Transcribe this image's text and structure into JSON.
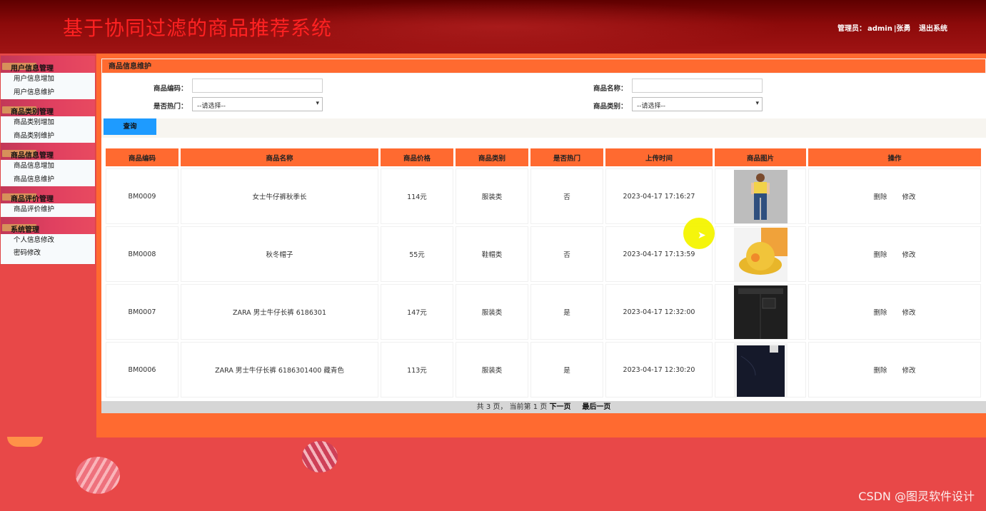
{
  "header": {
    "title": "基于协同过滤的商品推荐系统",
    "admin_label": "管理员：",
    "admin_name": "admin",
    "user_name": "张勇",
    "logout_label": "退出系统"
  },
  "sidebar": {
    "groups": [
      {
        "title": "用户信息管理",
        "items": [
          "用户信息增加",
          "用户信息维护"
        ]
      },
      {
        "title": "商品类别管理",
        "items": [
          "商品类别增加",
          "商品类别维护"
        ]
      },
      {
        "title": "商品信息管理",
        "items": [
          "商品信息增加",
          "商品信息维护"
        ]
      },
      {
        "title": "商品评价管理",
        "items": [
          "商品评价维护"
        ]
      },
      {
        "title": "系统管理",
        "items": [
          "个人信息修改",
          "密码修改"
        ]
      }
    ]
  },
  "panel": {
    "title": "商品信息维护",
    "search": {
      "code_label": "商品编码：",
      "code_value": "",
      "name_label": "商品名称：",
      "name_value": "",
      "hot_label": "是否热门：",
      "hot_selected": "--请选择--",
      "category_label": "商品类别：",
      "category_selected": "--请选择--",
      "button_label": "查询"
    },
    "table": {
      "headers": [
        "商品编码",
        "商品名称",
        "商品价格",
        "商品类别",
        "是否热门",
        "上传时间",
        "商品图片",
        "操作"
      ],
      "rows": [
        {
          "code": "BM0009",
          "name": "女士牛仔裤秋季长",
          "price": "114元",
          "category": "服装类",
          "hot": "否",
          "time": "2023-04-17 17:16:27",
          "image": "jeans-woman-image",
          "delete": "删除",
          "edit": "修改"
        },
        {
          "code": "BM0008",
          "name": "秋冬帽子",
          "price": "55元",
          "category": "鞋帽类",
          "hot": "否",
          "time": "2023-04-17 17:13:59",
          "image": "yellow-hat-image",
          "delete": "删除",
          "edit": "修改"
        },
        {
          "code": "BM0007",
          "name": "ZARA 男士牛仔长裤 6186301",
          "price": "147元",
          "category": "服装类",
          "hot": "是",
          "time": "2023-04-17 12:32:00",
          "image": "black-pants-image",
          "delete": "删除",
          "edit": "修改"
        },
        {
          "code": "BM0006",
          "name": "ZARA 男士牛仔长裤 6186301400 藏青色",
          "price": "113元",
          "category": "服装类",
          "hot": "是",
          "time": "2023-04-17 12:30:20",
          "image": "navy-pants-image",
          "delete": "删除",
          "edit": "修改"
        }
      ]
    },
    "pager": {
      "summary": "共 3 页， 当前第 1 页",
      "next": "下一页",
      "last": "最后一页"
    }
  },
  "watermark": "CSDN @图灵软件设计",
  "colors": {
    "header_dark": "#5e0000",
    "title_red": "#ff2222",
    "accent_orange": "#ff6a30",
    "button_blue": "#1e9bff",
    "background_red": "#e84848"
  }
}
